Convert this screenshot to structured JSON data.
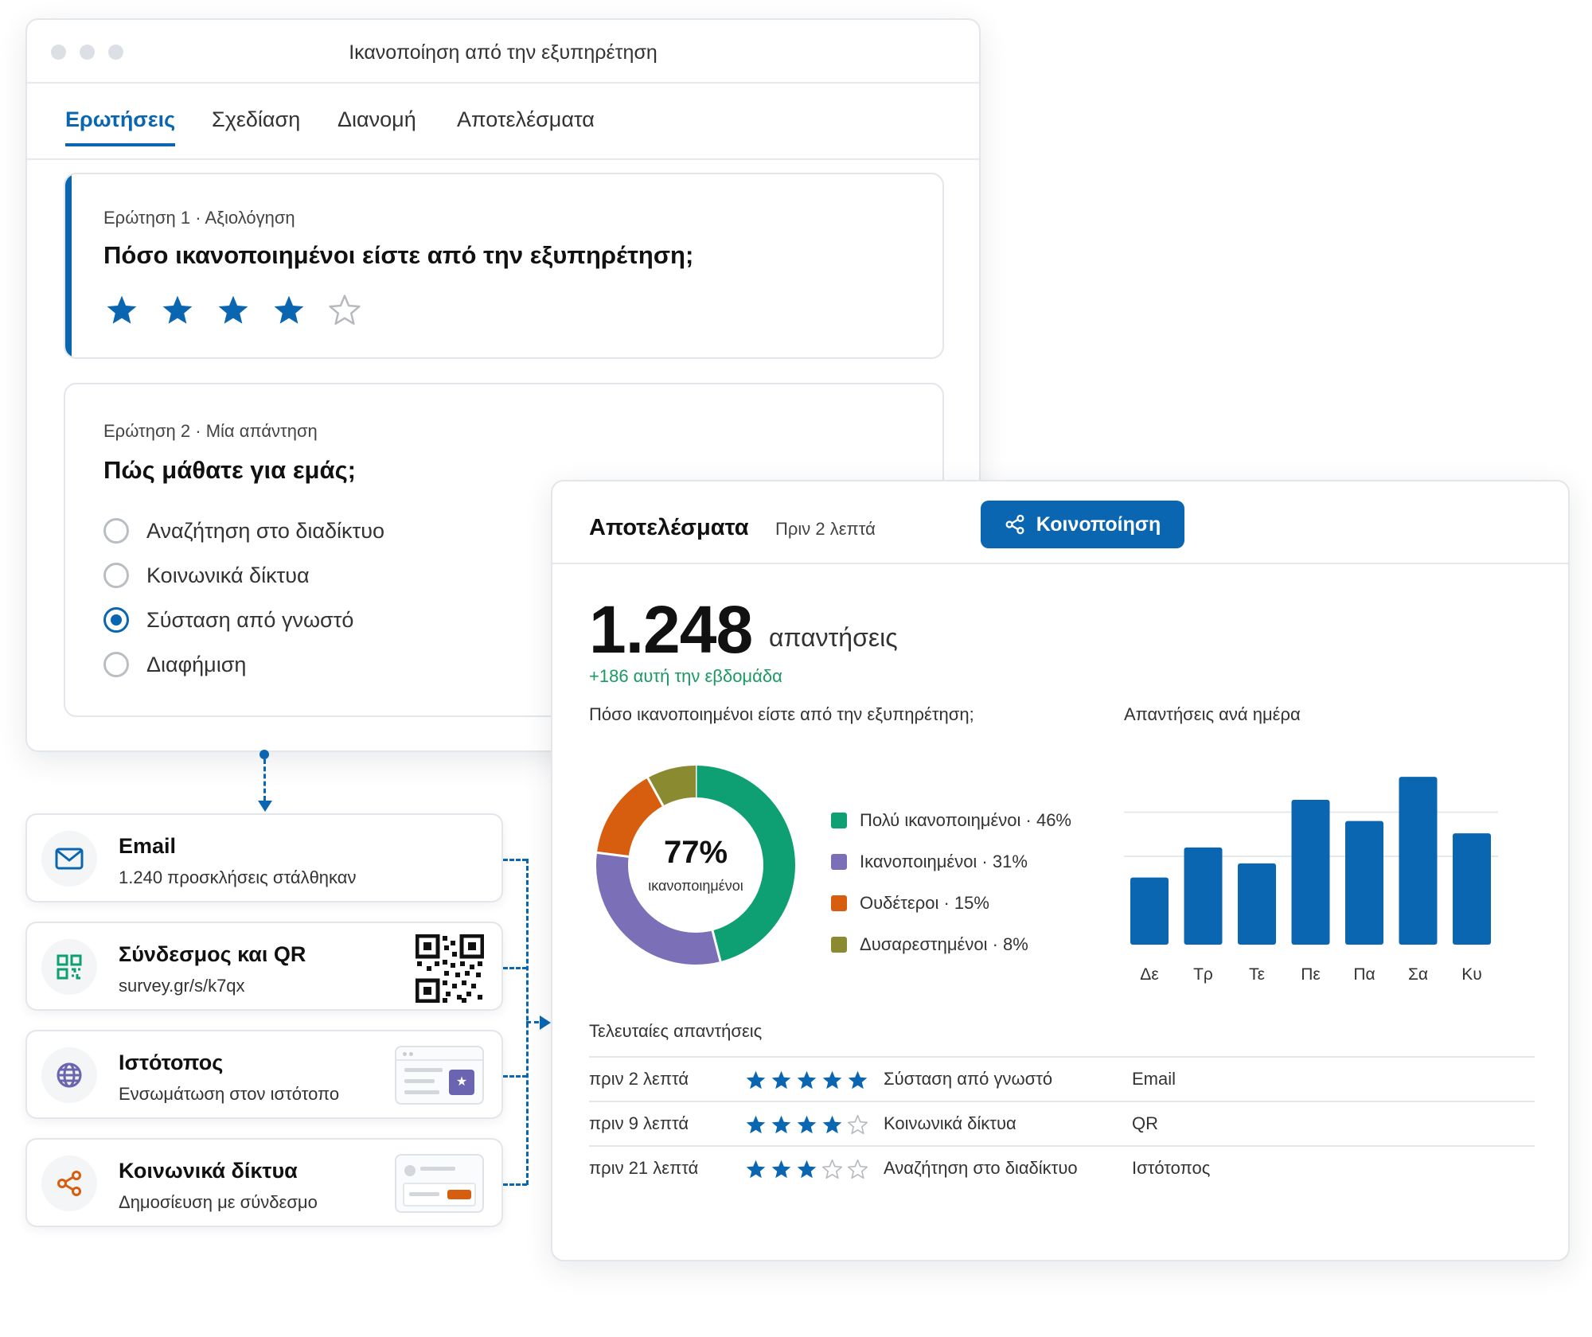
{
  "builder": {
    "title": "Ικανοποίηση από την εξυπηρέτηση",
    "tabs": [
      {
        "label": "Ερωτήσεις",
        "active": true
      },
      {
        "label": "Σχεδίαση",
        "active": false
      },
      {
        "label": "Διανομή",
        "active": false
      },
      {
        "label": "Αποτελέσματα",
        "active": false
      }
    ],
    "q1": {
      "meta": "Ερώτηση 1 · Αξιολόγηση",
      "text": "Πόσο ικανοποιημένοι είστε από την εξυπηρέτηση;",
      "rating": 4,
      "max": 5
    },
    "q2": {
      "meta": "Ερώτηση 2 · Μία απάντηση",
      "text": "Πώς μάθατε για εμάς;",
      "options": [
        {
          "label": "Αναζήτηση στο διαδίκτυο",
          "selected": false
        },
        {
          "label": "Κοινωνικά δίκτυα",
          "selected": false
        },
        {
          "label": "Σύσταση από γνωστό",
          "selected": true
        },
        {
          "label": "Διαφήμιση",
          "selected": false
        }
      ]
    }
  },
  "distribution": [
    {
      "title": "Email",
      "subtitle": "1.240 προσκλήσεις στάλθηκαν",
      "icon": "mail-icon"
    },
    {
      "title": "Σύνδεσμος και QR",
      "subtitle": "survey.gr/s/k7qx",
      "icon": "qr-code-icon"
    },
    {
      "title": "Ιστότοπος",
      "subtitle": "Ενσωμάτωση στον ιστότοπο",
      "icon": "globe-icon"
    },
    {
      "title": "Κοινωνικά δίκτυα",
      "subtitle": "Δημοσίευση με σύνδεσμο",
      "icon": "share-icon"
    }
  ],
  "results": {
    "title": "Αποτελέσματα",
    "time": "Πριν 2 λεπτά",
    "share_label": "Κοινοποίηση",
    "total": "1.248",
    "total_unit": "απαντήσεις",
    "trend": "+186 αυτή την εβδομάδα",
    "donut_title": "Πόσο ικανοποιημένοι είστε από την εξυπηρέτηση;",
    "donut_center_value": "77%",
    "donut_center_label": "ικανοποιημένοι",
    "bars_title": "Απαντήσεις ανά ημέρα",
    "recent_title": "Τελευταίες απαντήσεις",
    "recent": [
      {
        "time": "πριν 2 λεπτά",
        "stars": 5,
        "answer": "Σύσταση από γνωστό",
        "channel": "Email"
      },
      {
        "time": "πριν 9 λεπτά",
        "stars": 4,
        "answer": "Κοινωνικά δίκτυα",
        "channel": "QR"
      },
      {
        "time": "πριν 21 λεπτά",
        "stars": 3,
        "answer": "Αναζήτηση στο διαδίκτυο",
        "channel": "Ιστότοπος"
      }
    ]
  },
  "colors": {
    "accent": "#0b66b2",
    "very_satisfied": "#0ea072",
    "satisfied": "#7b70b8",
    "neutral": "#d75e0e",
    "dissatisfied": "#8a8a30",
    "positive_trend": "#1a9a64"
  },
  "chart_data": [
    {
      "type": "pie",
      "title": "Πόσο ικανοποιημένοι είστε από την εξυπηρέτηση;",
      "categories": [
        "Πολύ ικανοποιημένοι",
        "Ικανοποιημένοι",
        "Ουδέτεροι",
        "Δυσαρεστημένοι"
      ],
      "values": [
        46,
        31,
        15,
        8
      ],
      "legend_labels": [
        "Πολύ ικανοποιημένοι · 46%",
        "Ικανοποιημένοι · 31%",
        "Ουδέτεροι · 15%",
        "Δυσαρεστημένοι · 8%"
      ],
      "colors": [
        "#0ea072",
        "#7b70b8",
        "#d75e0e",
        "#8a8a30"
      ],
      "legend": "right"
    },
    {
      "type": "bar",
      "title": "Απαντήσεις ανά ημέρα",
      "categories": [
        "Δε",
        "Τρ",
        "Τε",
        "Πε",
        "Πα",
        "Σα",
        "Κυ"
      ],
      "values": [
        38,
        55,
        46,
        82,
        70,
        95,
        63
      ],
      "ylim": [
        0,
        100
      ],
      "grid": true,
      "color": "#0b66b2"
    }
  ]
}
